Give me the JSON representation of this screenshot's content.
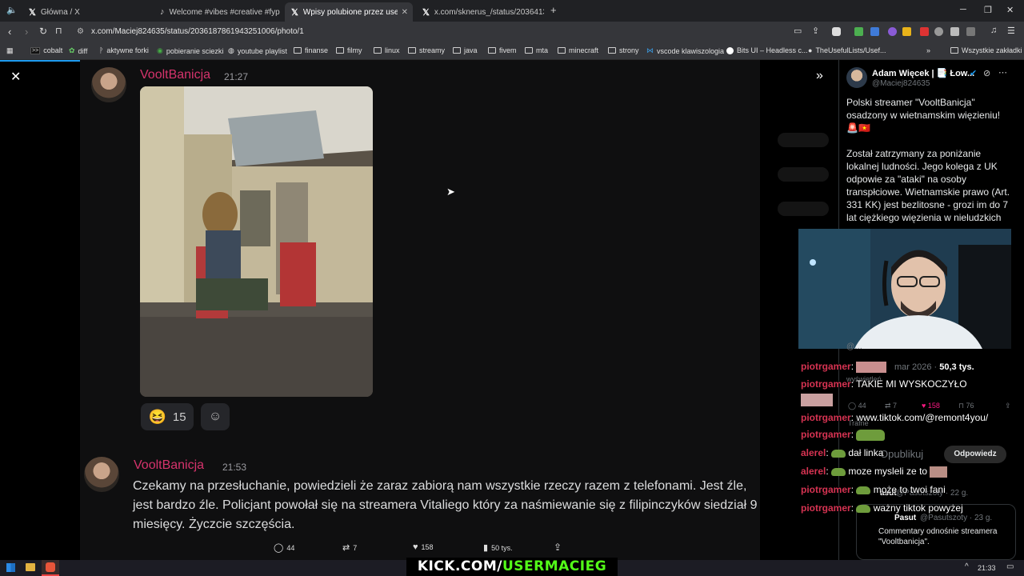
{
  "browser": {
    "tabs": [
      {
        "label": "Główna / X"
      },
      {
        "label": "Welcome #vibes #creative #fyp #vira"
      },
      {
        "label": "Wpisy polubione przez usermac"
      },
      {
        "label": "x.com/sknerus_/status/20364132169"
      }
    ],
    "url": "x.com/Maciej824635/status/2036187861943251006/photo/1",
    "bookmarks": [
      "cobalt",
      "diff",
      "aktywne forki",
      "pobieranie sciezki",
      "youtube playlist",
      "finanse",
      "filmy",
      "linux",
      "streamy",
      "java",
      "fivem",
      "mta",
      "minecraft",
      "strony",
      "vscode klawiszologia",
      "Bits UI – Headless c...",
      "TheUsefulLists/Usef..."
    ],
    "all_bookmarks": "Wszystkie zakładki"
  },
  "discord": {
    "msg1": {
      "author": "VooltBanicja",
      "time": "21:27"
    },
    "reaction_count": "15",
    "msg2": {
      "author": "VooltBanicja",
      "time": "21:53",
      "text": "Czekamy na przesłuchanie, powiedzieli że zaraz zabiorą nam wszystkie rzeczy razem z telefonami. Jest źle, jest bardzo źle. Policjant powołał się na streamera Vitaliego który za naśmiewanie się z filipinczyków siedział 9 miesięcy. Życzcie szczęścia."
    }
  },
  "tweet_actions": {
    "replies": "44",
    "reposts": "7",
    "likes": "158",
    "views": "50 tys."
  },
  "sidebar": {
    "author_name": "Adam Więcek | 📑 Łow...",
    "author_handle": "@Maciej824635",
    "tweet_p1": "Polski streamer \"VooltBanicja\" osadzony w wietnamskim więzieniu! 🚨🇻🇳",
    "tweet_p2": "Został zatrzymany za poniżanie lokalnej ludności. Jego kolega z UK odpowie za \"ataki\" na osoby transpłciowe. Wietnamskie prawo (Art. 331 KK) jest bezlitosne - grozi im do 7 lat ciężkiego więzienia w nieludzkich",
    "date_meta": "mar 2026 · ",
    "views_count": "50,3 tys.",
    "views_word": "wyświetleń",
    "stats": {
      "replies": "44",
      "reposts": "7",
      "likes": "158",
      "bookmarks": "76"
    },
    "relevant": "Trafne",
    "post_label": "Opublikuj",
    "reply_button": "Odpowiedz",
    "quote_user1": "asut",
    "quote_handle1": "@Pasutszoty · 22 g.",
    "quote_user2": "Pasut",
    "quote_handle2": "@Pasutszoty · 23 g.",
    "quote_text": "Commentary odnośnie streamera \"Vooltbanicja\"."
  },
  "stream_chat": [
    {
      "user": "piotrgamer",
      "msg": ""
    },
    {
      "user": "piotrgamer",
      "msg": "TAKIE MI WYSKOCZYŁO"
    },
    {
      "user": "piotrgamer",
      "msg": "www.tiktok.com/@remont4you/"
    },
    {
      "user": "piotrgamer",
      "msg": ""
    },
    {
      "user": "alerel",
      "msg": "dał linka"
    },
    {
      "user": "alerel",
      "msg": "moze mysleli ze to"
    },
    {
      "user": "piotrgamer",
      "msg": "może to twoi fani"
    },
    {
      "user": "piotrgamer",
      "msg": "ważny tiktok powyżej"
    }
  ],
  "overlay_banner": {
    "prefix": "KICK.COM/",
    "highlight": "USERMACIEG"
  },
  "taskbar": {
    "time": "21:33"
  }
}
